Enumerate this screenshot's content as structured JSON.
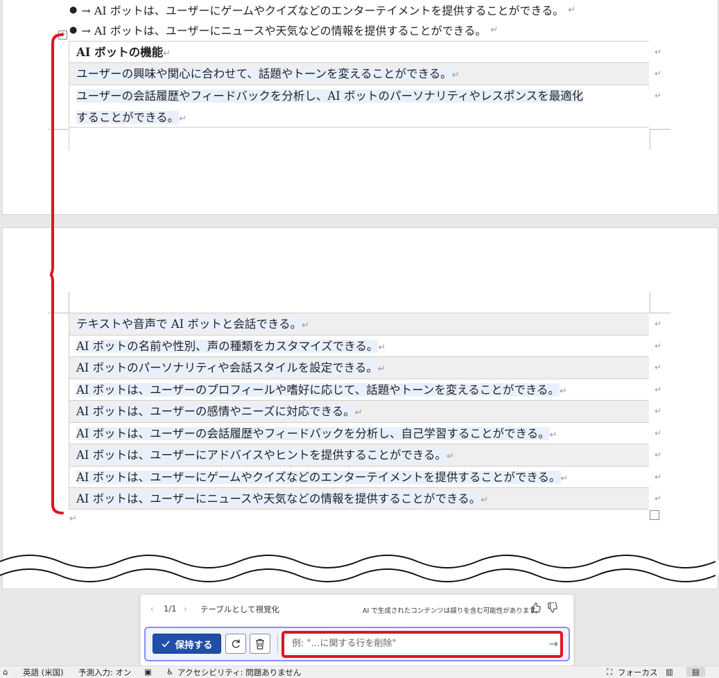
{
  "document": {
    "bullets": [
      "→ AI ボットは、ユーザーにゲームやクイズなどのエンターテイメントを提供することができる。",
      "→ AI ボットは、ユーザーにニュースや天気などの情報を提供することができる。"
    ],
    "bullet_glyph": "●",
    "pilcrow": "↵",
    "table1": {
      "header": "AI ボットの機能",
      "rows": [
        "ユーザーの興味や関心に合わせて、話題やトーンを変えることができる。",
        "ユーザーの会話履歴やフィードバックを分析し、AI ボットのパーソナリティやレスポンスを最適化",
        "することができる。"
      ]
    },
    "table2": {
      "rows": [
        "テキストや音声で AI ボットと会話できる。",
        "AI ボットの名前や性別、声の種類をカスタマイズできる。",
        "AI ボットのパーソナリティや会話スタイルを設定できる。",
        "AI ボットは、ユーザーのプロフィールや嗜好に応じて、話題やトーンを変えることができる。",
        "AI ボットは、ユーザーの感情やニーズに対応できる。",
        "AI ボットは、ユーザーの会話履歴やフィードバックを分析し、自己学習することができる。",
        "AI ボットは、ユーザーにアドバイスやヒントを提供することができる。",
        "AI ボットは、ユーザーにゲームやクイズなどのエンターテイメントを提供することができる。",
        "AI ボットは、ユーザーにニュースや天気などの情報を提供することができる。"
      ]
    }
  },
  "ai_panel": {
    "nav_prev": "‹",
    "nav_next": "›",
    "counter": "1/1",
    "title": "テーブルとして視覚化",
    "disclaimer": "AI で生成されたコンテンツは誤りを含む可能性があります。",
    "keep_label": "保持する",
    "prompt_placeholder": "例: \"…に関する行を削除\""
  },
  "statusbar": {
    "language": "英語 (米国)",
    "predictive": "予測入力: オン",
    "accessibility": "アクセシビリティ: 問題ありません",
    "focus": "フォーカス"
  },
  "colors": {
    "accent_red": "#e0141e",
    "keep_button": "#1f4fa8",
    "highlight": "#e8f0fe"
  },
  "icons": [
    "table-move-icon",
    "check-icon",
    "regenerate-icon",
    "trash-icon",
    "send-arrow-icon",
    "thumbs-up-icon",
    "thumbs-down-icon",
    "read-mode-icon",
    "print-layout-icon",
    "focus-icon",
    "accessibility-icon",
    "macro-icon"
  ]
}
